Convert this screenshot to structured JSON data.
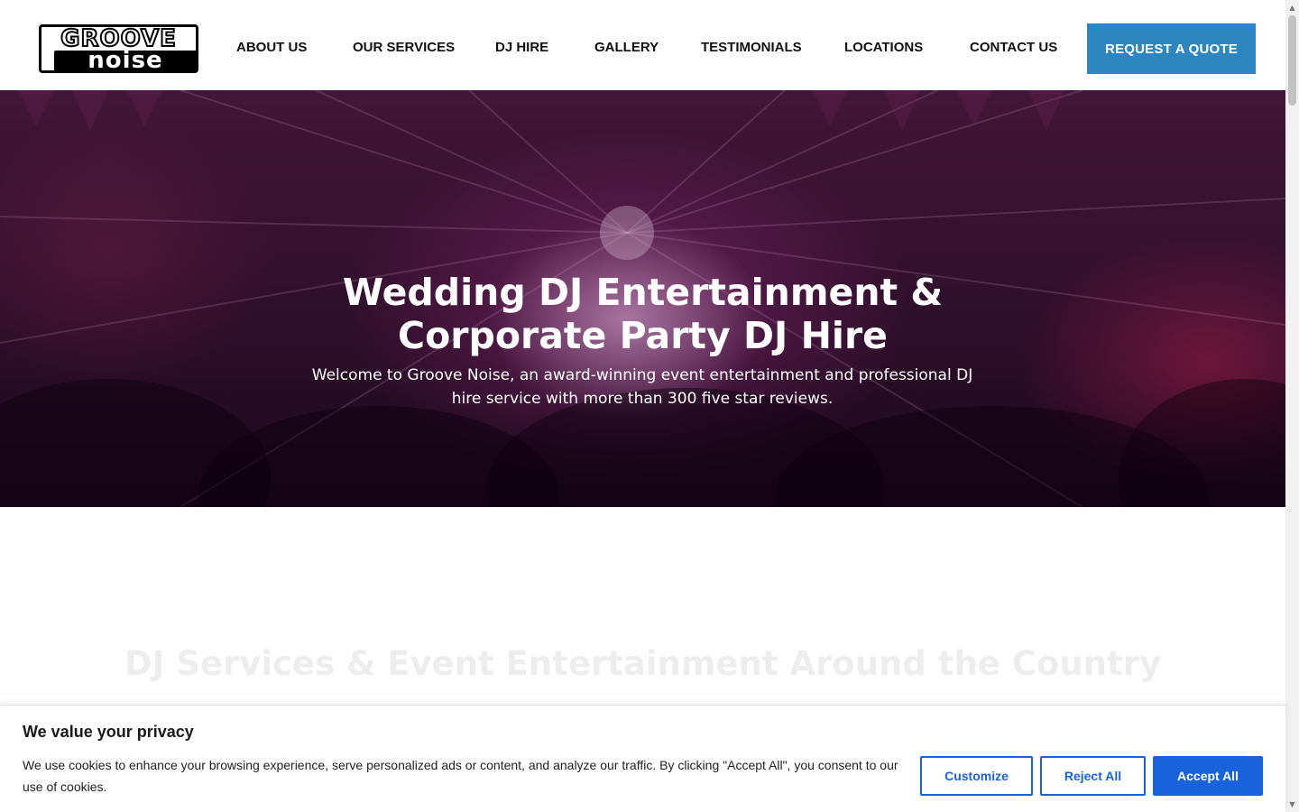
{
  "header": {
    "logo_top": "GROOVE",
    "logo_bottom": "noise",
    "nav": [
      "ABOUT US",
      "OUR SERVICES",
      "DJ HIRE",
      "GALLERY",
      "TESTIMONIALS",
      "LOCATIONS",
      "CONTACT US"
    ],
    "cta_label": "REQUEST A QUOTE"
  },
  "hero": {
    "title_line1": "Wedding DJ Entertainment &",
    "title_line2": "Corporate Party DJ Hire",
    "subtitle_line1": "Welcome to Groove Noise, an award-winning event entertainment and professional DJ",
    "subtitle_line2": "hire service with more than 300 five star reviews."
  },
  "section": {
    "faded_title": "DJ Services & Event Entertainment Around the Country"
  },
  "cookie": {
    "title": "We value your privacy",
    "text": "We use cookies to enhance your browsing experience, serve personalized ads or content, and analyze our traffic. By clicking \"Accept All\", you consent to our use of cookies.",
    "customize_label": "Customize",
    "reject_label": "Reject All",
    "accept_label": "Accept All"
  },
  "colors": {
    "cta": "#2e86c1",
    "cookie_accent": "#1863dc"
  },
  "icons": {
    "scroll_up": "triangle-up-icon",
    "scroll_down": "triangle-down-icon"
  }
}
